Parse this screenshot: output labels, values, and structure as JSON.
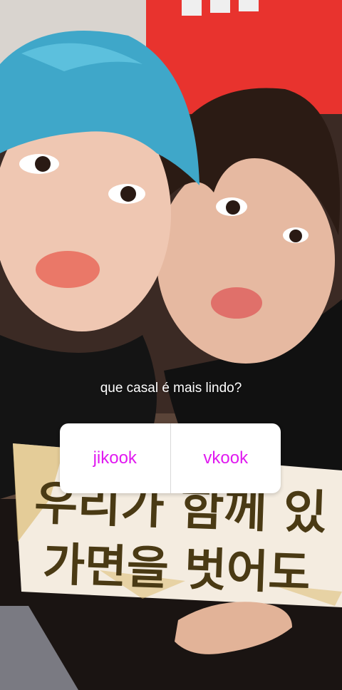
{
  "story": {
    "question": "que casal é mais lindo?",
    "options": [
      {
        "label": "jikook"
      },
      {
        "label": "vkook"
      }
    ],
    "banner": {
      "line1": "우리가 함께 있",
      "line2": "가면을 벗어도"
    },
    "colors": {
      "option_text": "#e01af0",
      "wall_red": "#e8332e",
      "hair_blue": "#3fa7c9"
    }
  }
}
